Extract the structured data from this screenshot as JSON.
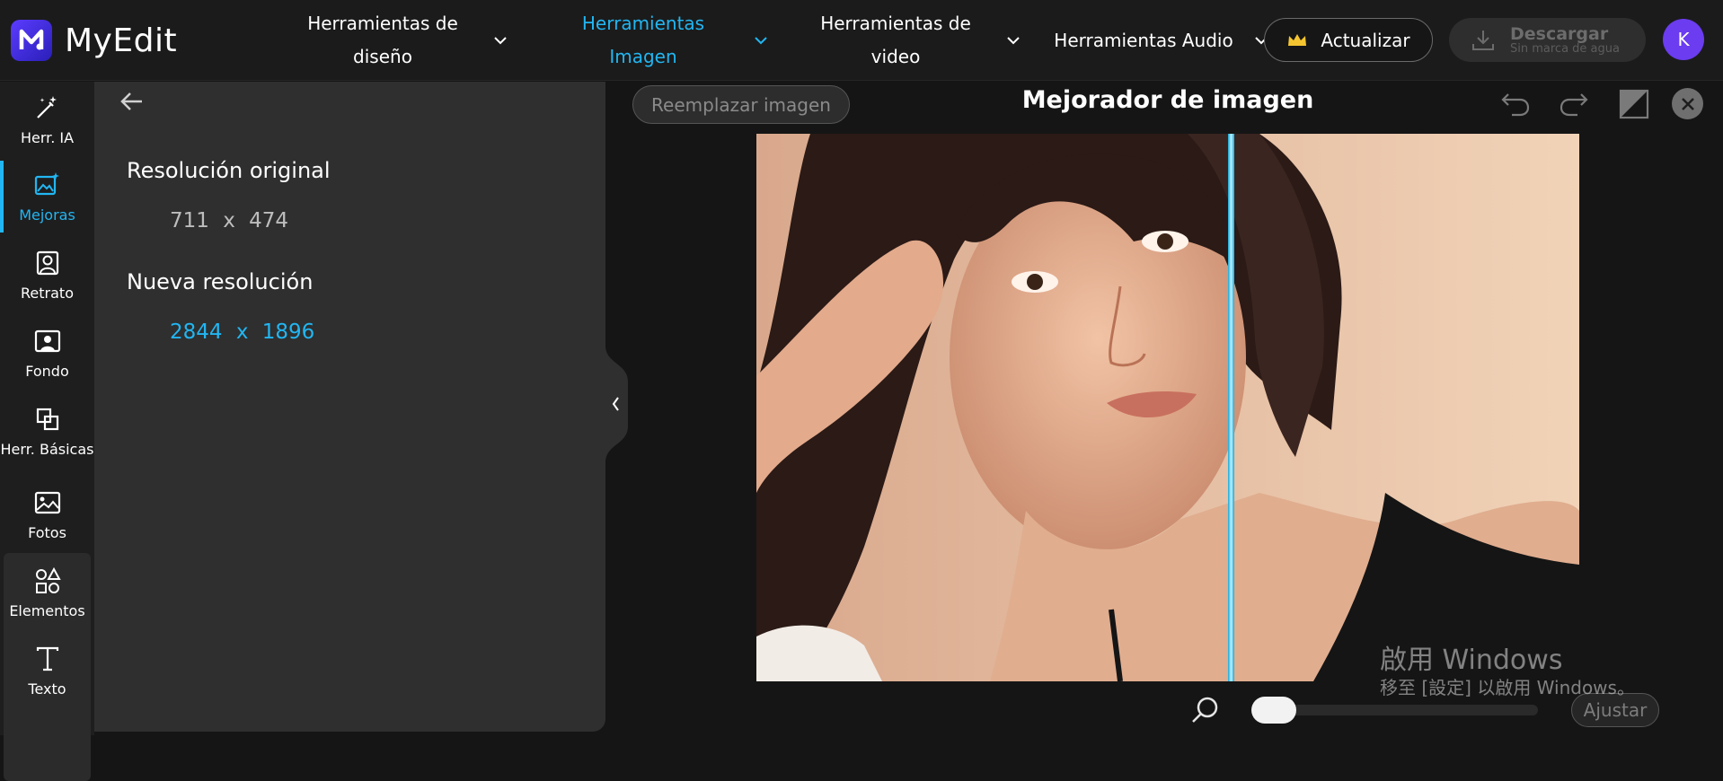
{
  "app": {
    "name": "MyEdit"
  },
  "nav": {
    "items": [
      {
        "label": "Herramientas de diseño",
        "active": false
      },
      {
        "label": "Herramientas Imagen",
        "active": true
      },
      {
        "label": "Herramientas de video",
        "active": false
      },
      {
        "label": "Herramientas Audio",
        "active": false
      }
    ],
    "upgrade_label": "Actualizar",
    "download_label": "Descargar",
    "download_sublabel": "Sin marca de agua",
    "avatar_initial": "K"
  },
  "rail": {
    "items": [
      {
        "label": "Herr. IA",
        "icon": "magic-wand-icon"
      },
      {
        "label": "Mejoras",
        "icon": "enhance-image-icon",
        "active": true
      },
      {
        "label": "Retrato",
        "icon": "portrait-icon"
      },
      {
        "label": "Fondo",
        "icon": "background-icon"
      },
      {
        "label": "Herr. Básicas",
        "icon": "crop-icon"
      },
      {
        "label": "Fotos",
        "icon": "photo-icon"
      },
      {
        "label": "Elementos",
        "icon": "elements-icon"
      },
      {
        "label": "Texto",
        "icon": "text-icon"
      }
    ]
  },
  "panel": {
    "original_title": "Resolución original",
    "original_value": "711 x 474",
    "new_title": "Nueva resolución",
    "new_value": "2844 x 1896"
  },
  "workspace": {
    "replace_label": "Reemplazar imagen",
    "title": "Mejorador de imagen",
    "fit_label": "Ajustar"
  },
  "watermark": {
    "line1": "啟用 Windows",
    "line2": "移至 [設定] 以啟用 Windows。"
  },
  "colors": {
    "accent": "#22b6f2",
    "brand": "#5b3cff"
  }
}
